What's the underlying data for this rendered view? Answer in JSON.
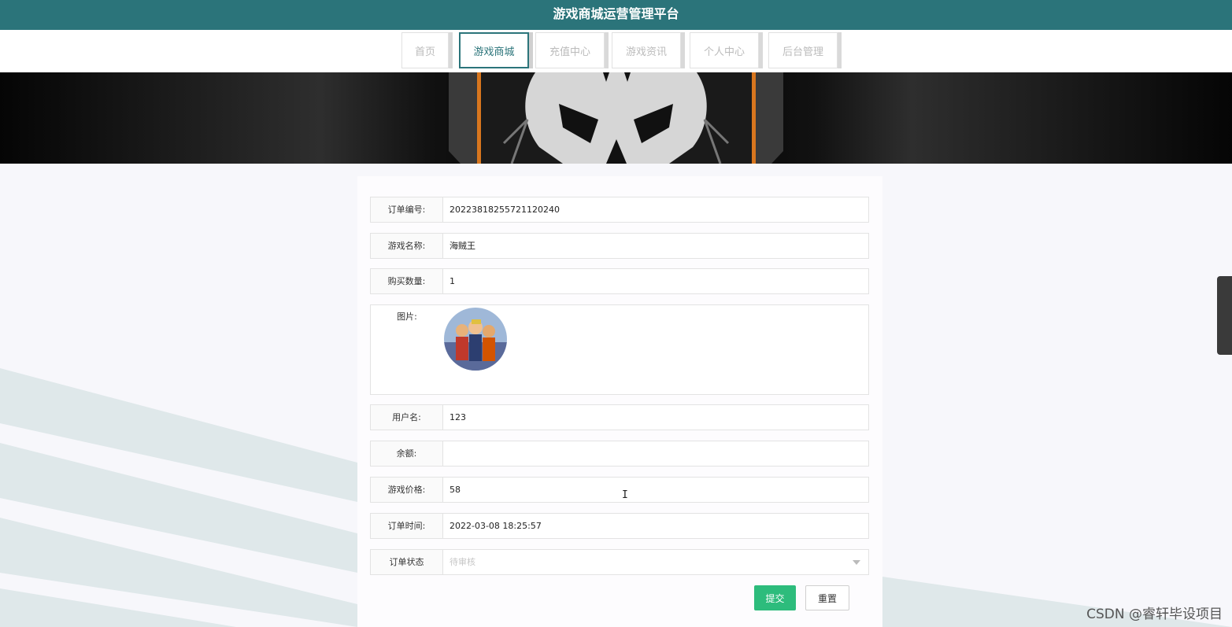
{
  "app": {
    "title": "游戏商城运营管理平台"
  },
  "nav": {
    "tabs": [
      {
        "label": "首页"
      },
      {
        "label": "游戏商城",
        "active": true
      },
      {
        "label": "充值中心"
      },
      {
        "label": "游戏资讯"
      },
      {
        "label": "个人中心"
      },
      {
        "label": "后台管理"
      }
    ]
  },
  "form": {
    "order_no": {
      "label": "订单编号:",
      "value": "20223818255721120240"
    },
    "game_name": {
      "label": "游戏名称:",
      "value": "海贼王"
    },
    "quantity": {
      "label": "购买数量:",
      "value": "1"
    },
    "image": {
      "label": "图片:",
      "icon": "game-thumbnail-image"
    },
    "username": {
      "label": "用户名:",
      "value": "123"
    },
    "balance": {
      "label": "余额:",
      "value": ""
    },
    "price": {
      "label": "游戏价格:",
      "value": "58"
    },
    "order_time": {
      "label": "订单时间:",
      "value": "2022-03-08 18:25:57"
    },
    "status": {
      "label": "订单状态",
      "placeholder": "待审核"
    },
    "submit_label": "提交",
    "reset_label": "重置"
  },
  "watermark": "CSDN @睿轩毕设项目",
  "colors": {
    "header": "#2b747a",
    "submit": "#2dbc7c"
  }
}
